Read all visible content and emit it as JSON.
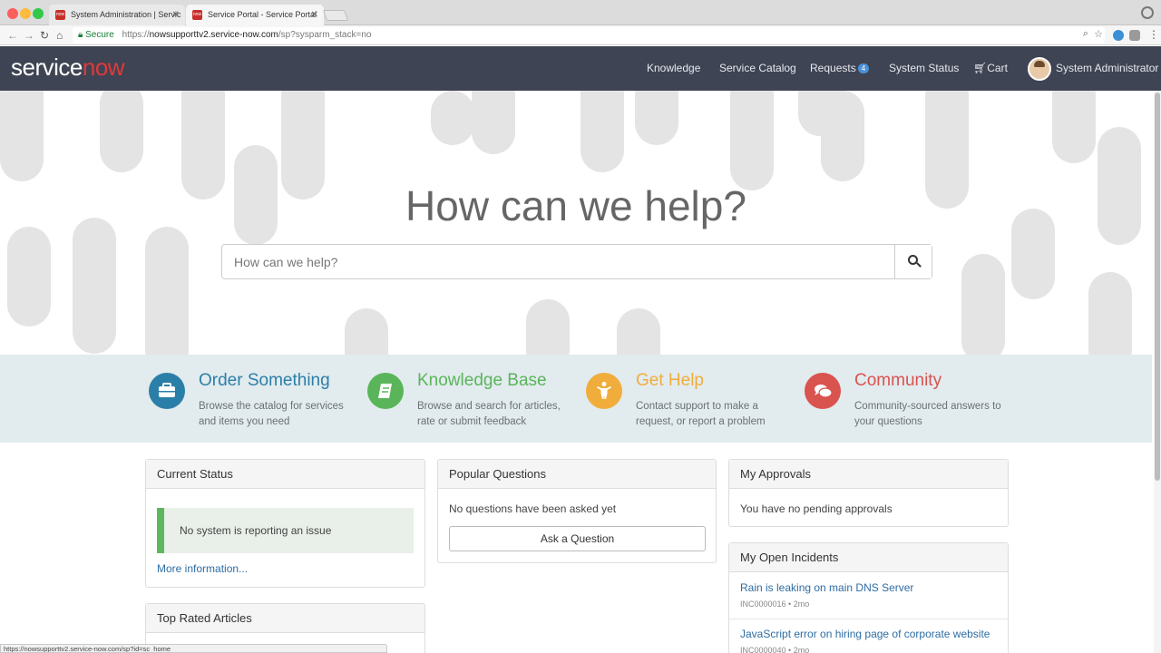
{
  "browser": {
    "tabs": [
      {
        "title": "System Administration | Servic",
        "favicon": "now"
      },
      {
        "title": "Service Portal - Service Portal",
        "favicon": "now"
      }
    ],
    "url": {
      "secure_label": "Secure",
      "scheme": "https://",
      "host": "nowsupporttv2.service-now.com",
      "path": "/sp?sysparm_stack=no"
    },
    "status_url": "https://nowsupporttv2.service-now.com/sp?id=sc_home"
  },
  "header": {
    "logo_service": "service",
    "logo_now": "now",
    "nav": {
      "knowledge": "Knowledge",
      "service_catalog": "Service Catalog",
      "requests": "Requests",
      "requests_count": "4",
      "system_status": "System Status",
      "cart": "Cart",
      "user": "System Administrator"
    }
  },
  "hero": {
    "title": "How can we help?",
    "search_placeholder": "How can we help?"
  },
  "quick_links": [
    {
      "title": "Order Something",
      "desc": "Browse the catalog for services and items you need",
      "color": "#2a7fa8",
      "icon": "briefcase-icon"
    },
    {
      "title": "Knowledge Base",
      "desc": "Browse and search for articles, rate or submit feedback",
      "color": "#5ab55a",
      "icon": "book-icon"
    },
    {
      "title": "Get Help",
      "desc": "Contact support to make a request, or report a problem",
      "color": "#f0ad3c",
      "icon": "person-icon"
    },
    {
      "title": "Community",
      "desc": "Community-sourced answers to your questions",
      "color": "#d9534f",
      "icon": "chat-icon"
    }
  ],
  "widgets": {
    "current_status": {
      "title": "Current Status",
      "message": "No system is reporting an issue",
      "more": "More information..."
    },
    "top_rated": {
      "title": "Top Rated Articles"
    },
    "popular_questions": {
      "title": "Popular Questions",
      "empty": "No questions have been asked yet",
      "button": "Ask a Question"
    },
    "my_approvals": {
      "title": "My Approvals",
      "empty": "You have no pending approvals"
    },
    "my_open_incidents": {
      "title": "My Open Incidents",
      "items": [
        {
          "title": "Rain is leaking on main DNS Server",
          "meta": "INC0000016 • 2mo"
        },
        {
          "title": "JavaScript error on hiring page of corporate website",
          "meta": "INC0000040 • 2mo"
        }
      ]
    }
  }
}
